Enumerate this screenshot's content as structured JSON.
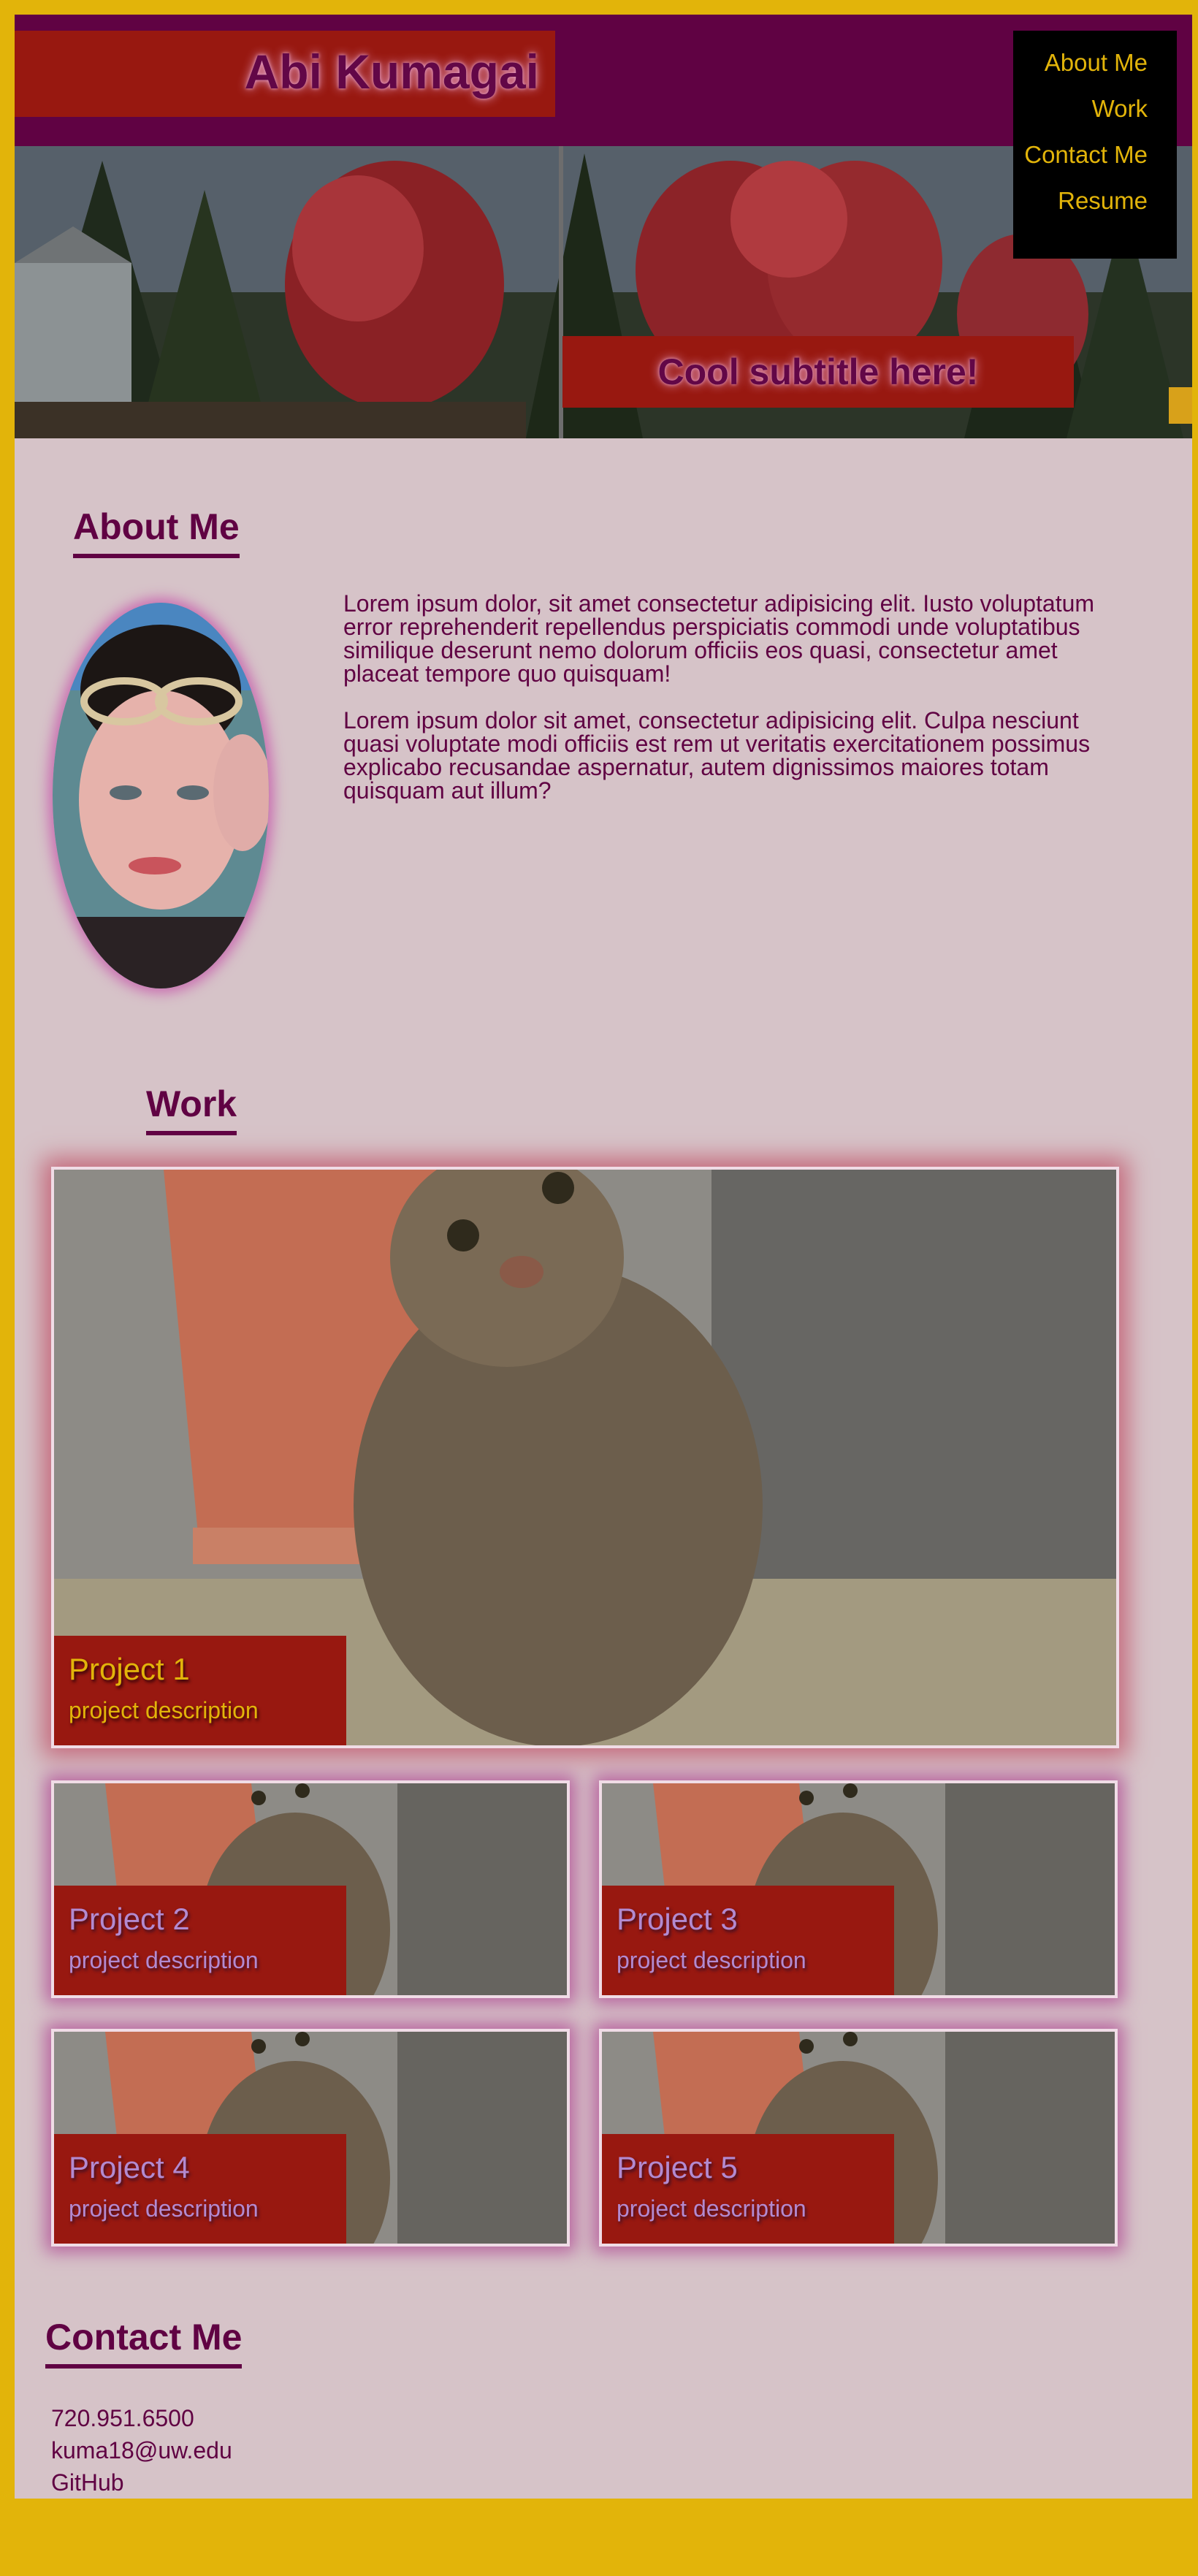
{
  "header": {
    "title": "Abi Kumagai"
  },
  "nav": {
    "items": [
      "About Me",
      "Work",
      "Contact Me",
      "Resume"
    ]
  },
  "hero": {
    "subtitle": "Cool subtitle here!"
  },
  "about": {
    "heading": "About Me",
    "paragraphs": [
      "Lorem ipsum dolor, sit amet consectetur adipisicing elit. Iusto voluptatum error reprehenderit repellendus perspiciatis commodi unde voluptatibus similique deserunt nemo dolorum officiis eos quasi, consectetur amet placeat tempore quo quisquam!",
      "Lorem ipsum dolor sit amet, consectetur adipisicing elit. Culpa nesciunt quasi voluptate modi officiis est rem ut veritatis exercitationem possimus explicabo recusandae aspernatur, autem dignissimos maiores totam quisquam aut illum?"
    ]
  },
  "work": {
    "heading": "Work",
    "projects": [
      {
        "title": "Project 1",
        "description": "project description"
      },
      {
        "title": "Project 2",
        "description": "project description"
      },
      {
        "title": "Project 3",
        "description": "project description"
      },
      {
        "title": "Project 4",
        "description": "project description"
      },
      {
        "title": "Project 5",
        "description": "project description"
      }
    ]
  },
  "contact": {
    "heading": "Contact Me",
    "phone": "720.951.6500",
    "email": "kuma18@uw.edu",
    "github": "GitHub"
  },
  "colors": {
    "page_border": "#e2b40a",
    "header_bg": "#600243",
    "accent_red": "#981810",
    "body_bg": "#d6c3c8",
    "nav_text": "#e2b40a"
  }
}
